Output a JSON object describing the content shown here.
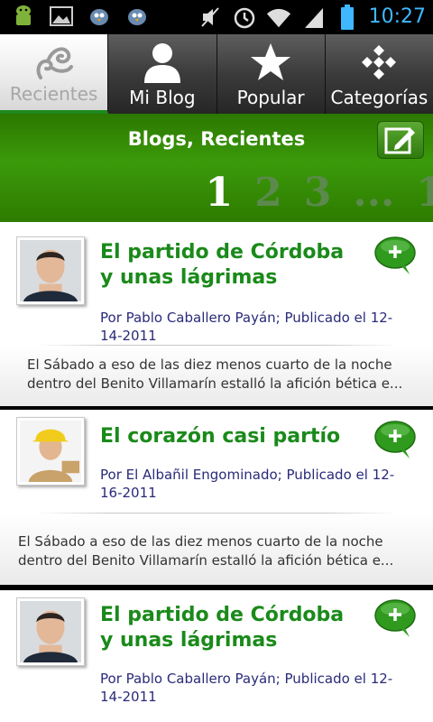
{
  "status_bar": {
    "time": "10:27",
    "left_icons": [
      "android-icon",
      "image-icon",
      "bird-icon",
      "bird-icon"
    ],
    "right_icons": [
      "mute-icon",
      "alarm-icon",
      "wifi-icon",
      "signal-icon",
      "battery-icon"
    ]
  },
  "tabs": [
    {
      "label": "Recientes",
      "icon": "recent-icon",
      "active": true
    },
    {
      "label": "Mi Blog",
      "icon": "person-icon",
      "active": false
    },
    {
      "label": "Popular",
      "icon": "star-icon",
      "active": false
    },
    {
      "label": "Categorías",
      "icon": "categories-icon",
      "active": false
    }
  ],
  "header": {
    "title": "Blogs, Recientes",
    "compose_icon": "compose-icon",
    "pages": [
      "1",
      "2",
      "3",
      "...",
      "1"
    ],
    "current_page": "1"
  },
  "posts": [
    {
      "title": "El partido de Córdoba y unas lágrimas",
      "byline": "Por Pablo Caballero Payán; Publicado el 12-14-2011",
      "excerpt": "El Sábado a eso de las diez menos cuarto de la noche dentro del Benito Villamarín estalló la afición bética e...",
      "avatar": "man-photo"
    },
    {
      "title": "El corazón casi partío",
      "byline": "Por El Albañil Engominado; Publicado el 12-16-2011",
      "excerpt": "El Sábado a eso de las diez menos cuarto de la noche dentro del Benito Villamarín estalló la afición bética e...",
      "avatar": "worker-photo"
    },
    {
      "title": "El partido de Córdoba y unas lágrimas",
      "byline": "Por Pablo Caballero Payán; Publicado el 12-14-2011",
      "excerpt": "",
      "avatar": "man-photo"
    }
  ],
  "colors": {
    "green": "#2e8b1e",
    "title_green": "#1a8a1a",
    "byline": "#2a2a7a",
    "time": "#3fb8ff"
  }
}
